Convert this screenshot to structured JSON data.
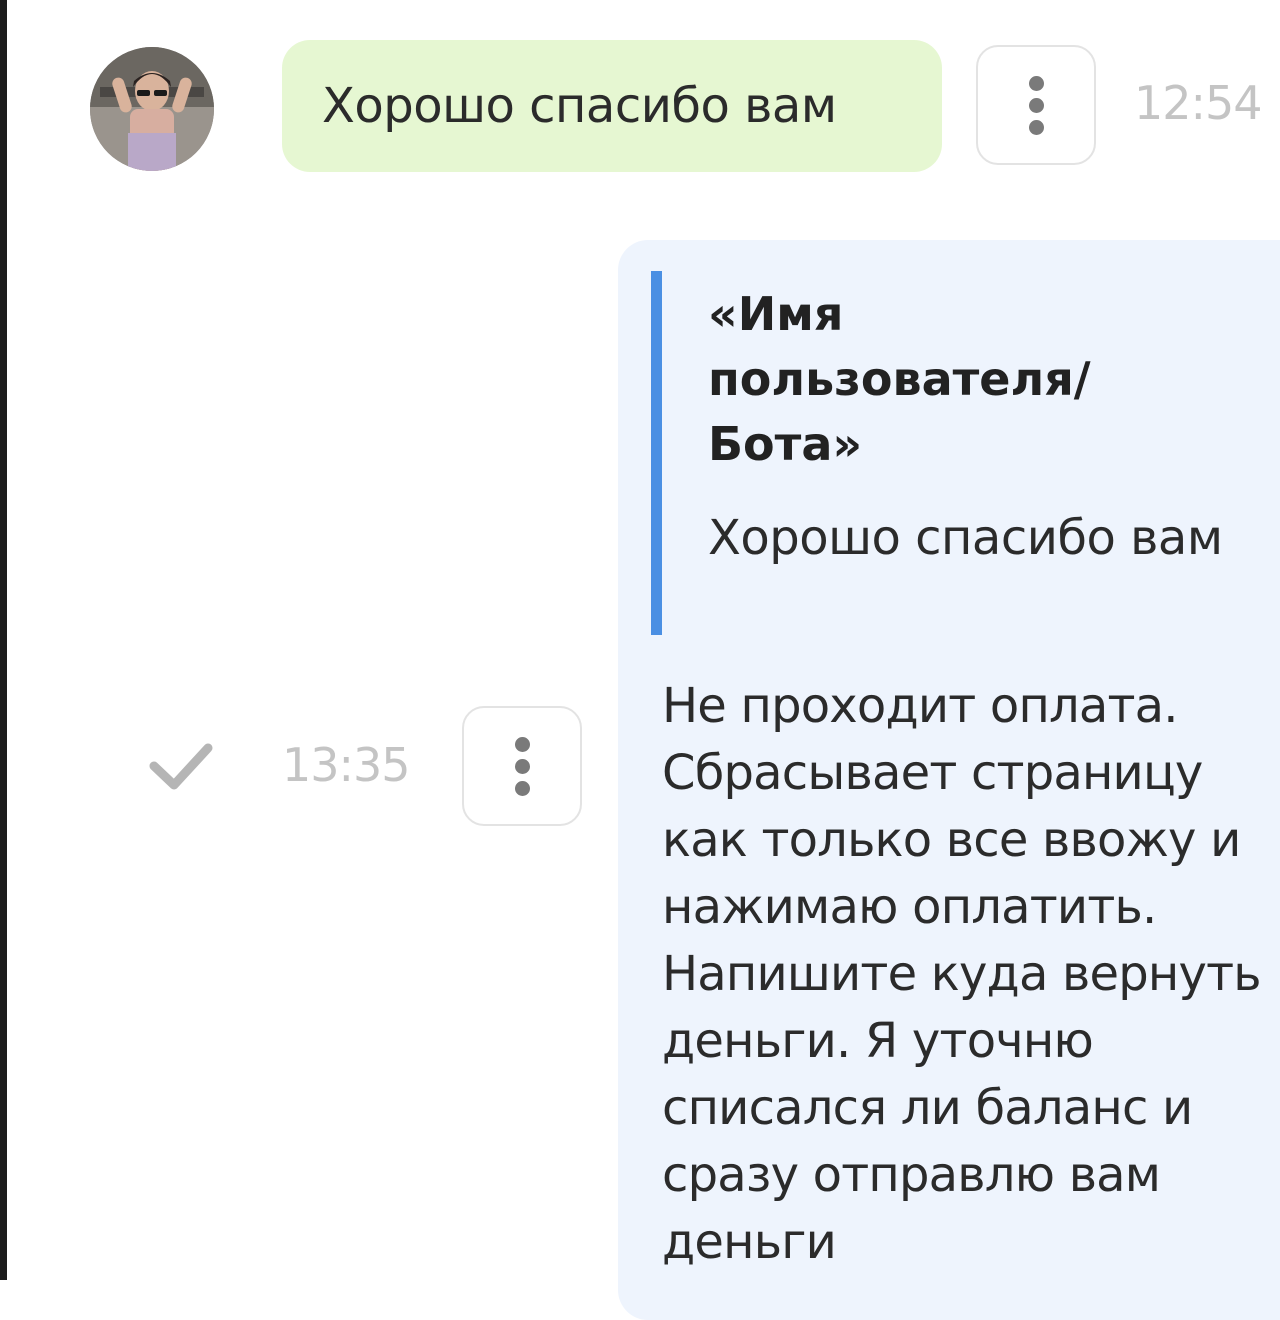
{
  "messages": [
    {
      "direction": "incoming",
      "text": "Хорошо спасибо вам",
      "time": "12:54",
      "bubble_color": "#e6f7d2",
      "avatar_icon": "user-photo-avatar",
      "menu_icon": "more-vertical-icon"
    },
    {
      "direction": "outgoing",
      "quote": {
        "author": "«Имя пользователя/ Бота»",
        "text": "Хорошо спасибо вам",
        "bar_color": "#4a8fe3"
      },
      "text": "Не проходит оплата. Сбрасывает страницу как только все ввожу и нажимаю оплатить. Напишите куда вернуть деньги. Я уточню списался ли баланс и сразу отправлю вам деньги",
      "time": "13:35",
      "status_icon": "check-icon",
      "bubble_color": "#eef4fd",
      "menu_icon": "more-vertical-icon"
    }
  ]
}
